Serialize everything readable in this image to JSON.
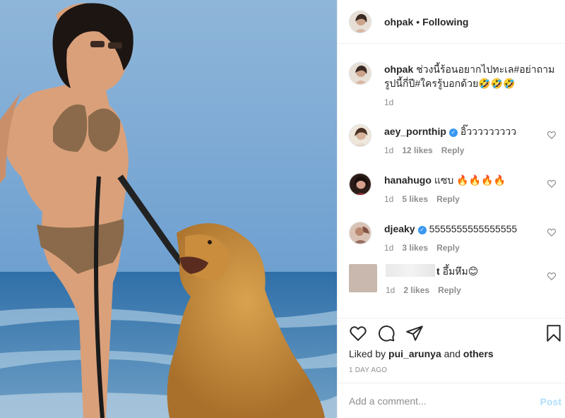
{
  "post": {
    "photo_alt": "woman in leopard bikini with golden retriever on beach"
  },
  "header": {
    "username": "ohpak",
    "separator": "•",
    "follow_status": "Following"
  },
  "caption": {
    "username": "ohpak",
    "text": "ช่วงนี้ร้อนอยากไปทะเล#อย่าถามรูปนี้กี่ปี#ใครรู้บอกด้วย🤣🤣🤣",
    "age": "1d"
  },
  "comments": [
    {
      "username": "aey_pornthip",
      "verified": true,
      "text": "อิ๊ววววววววว",
      "age": "1d",
      "likes": "12 likes",
      "reply": "Reply"
    },
    {
      "username": "hanahugo",
      "verified": false,
      "text": "แซบ 🔥🔥🔥🔥",
      "age": "1d",
      "likes": "5 likes",
      "reply": "Reply"
    },
    {
      "username": "djeaky",
      "verified": true,
      "text": "5555555555555555",
      "age": "1d",
      "likes": "3 likes",
      "reply": "Reply"
    },
    {
      "username": "t",
      "verified": false,
      "text": "อึ้มหึม😊",
      "age": "1d",
      "likes": "2 likes",
      "reply": "Reply"
    }
  ],
  "actions": {
    "liked_prefix": "Liked by",
    "liked_user": "pui_arunya",
    "liked_and": "and",
    "liked_others": "others",
    "post_age": "1 DAY AGO"
  },
  "add_comment": {
    "placeholder": "Add a comment...",
    "post_label": "Post"
  },
  "icons": [
    "heart-icon",
    "comment-icon",
    "share-icon",
    "bookmark-icon"
  ]
}
